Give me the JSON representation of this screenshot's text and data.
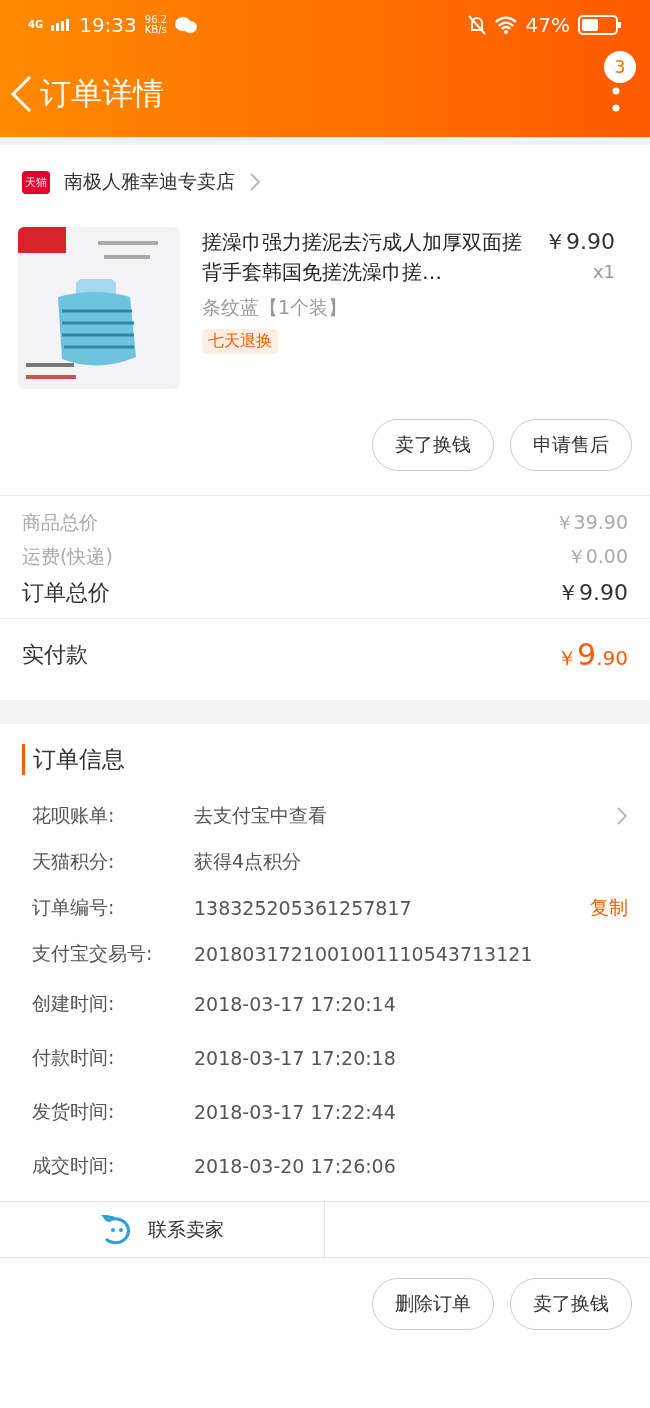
{
  "status_bar": {
    "network": "4G",
    "time": "19:33",
    "speed_value": "96.2",
    "speed_unit": "KB/s",
    "battery": "47%"
  },
  "header": {
    "title": "订单详情",
    "badge": "3"
  },
  "store": {
    "badge": "天猫",
    "name": "南极人雅幸迪专卖店"
  },
  "product": {
    "title": "搓澡巾强力搓泥去污成人加厚双面搓背手套韩国免搓洗澡巾搓…",
    "price": "￥9.90",
    "quantity": "x1",
    "variant": "条纹蓝【1个装】",
    "tag": "七天退换"
  },
  "item_actions": [
    "卖了换钱",
    "申请售后"
  ],
  "summary": [
    {
      "label": "商品总价",
      "value": "￥39.90",
      "kind": "minor"
    },
    {
      "label": "运费(快递)",
      "value": "￥0.00",
      "kind": "minor"
    },
    {
      "label": "订单总价",
      "value": "￥9.90",
      "kind": "major"
    }
  ],
  "paid": {
    "label": "实付款",
    "currency": "￥",
    "integer": "9",
    "decimal": ".90"
  },
  "order_info": {
    "title": "订单信息",
    "rows": [
      {
        "label": "花呗账单:",
        "value": "去支付宝中查看",
        "kind": "link"
      },
      {
        "label": "天猫积分:",
        "value": "获得4点积分",
        "kind": "plain"
      },
      {
        "label": "订单编号:",
        "value": "138325205361257817",
        "action": "复制",
        "kind": "copy"
      },
      {
        "label": "支付宝交易号:",
        "value": "2018031721001001110543713121",
        "kind": "plain"
      },
      {
        "label": "创建时间:",
        "value": "2018-03-17 17:20:14",
        "kind": "time"
      },
      {
        "label": "付款时间:",
        "value": "2018-03-17 17:20:18",
        "kind": "time"
      },
      {
        "label": "发货时间:",
        "value": "2018-03-17 17:22:44",
        "kind": "time"
      },
      {
        "label": "成交时间:",
        "value": "2018-03-20 17:26:06",
        "kind": "time"
      }
    ]
  },
  "contact": {
    "label": "联系卖家"
  },
  "bottom_actions": [
    "删除订单",
    "卖了换钱"
  ]
}
